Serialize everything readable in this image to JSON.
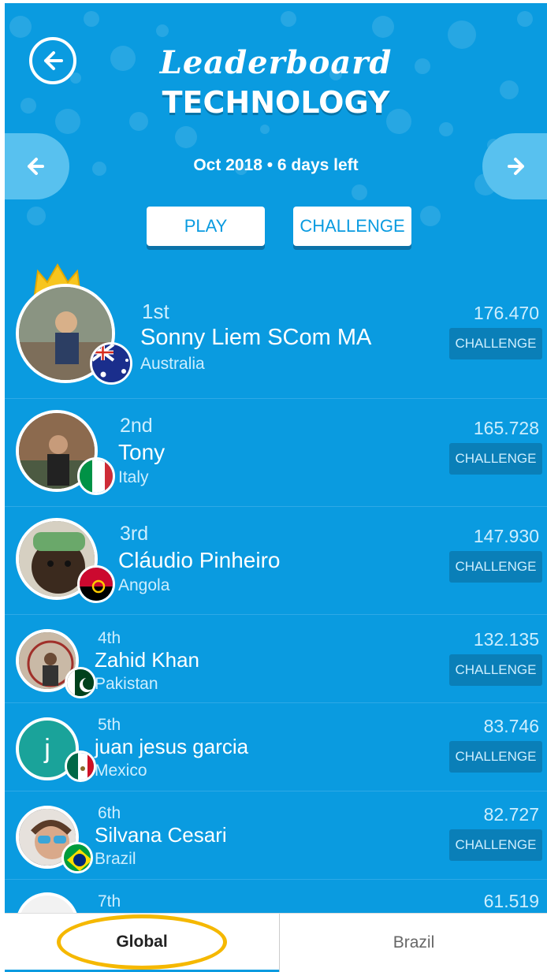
{
  "header": {
    "title_script": "Leaderboard",
    "title_main": "TECHNOLOGY",
    "period": "Oct 2018 • 6 days left",
    "play_label": "PLAY",
    "challenge_label": "CHALLENGE"
  },
  "list": {
    "challenge_label": "CHALLENGE",
    "entries": [
      {
        "rank": "1st",
        "name": "Sonny Liem SCom MA",
        "country": "Australia",
        "score": "176.470"
      },
      {
        "rank": "2nd",
        "name": "Tony",
        "country": "Italy",
        "score": "165.728"
      },
      {
        "rank": "3rd",
        "name": "Cláudio Pinheiro",
        "country": "Angola",
        "score": "147.930"
      },
      {
        "rank": "4th",
        "name": "Zahid Khan",
        "country": "Pakistan",
        "score": "132.135"
      },
      {
        "rank": "5th",
        "name": "juan jesus garcia",
        "country": "Mexico",
        "score": "83.746",
        "avatar_letter": "j"
      },
      {
        "rank": "6th",
        "name": "Silvana Cesari",
        "country": "Brazil",
        "score": "82.727"
      },
      {
        "rank": "7th",
        "score": "61.519"
      }
    ]
  },
  "tabs": {
    "global": "Global",
    "brazil": "Brazil"
  },
  "colors": {
    "background": "#0a9be0",
    "challenge_button": "#0a7fb8",
    "highlight": "#f5b800"
  },
  "icons": [
    "back-arrow-icon",
    "arrow-left-icon",
    "arrow-right-icon",
    "crown-icon"
  ]
}
